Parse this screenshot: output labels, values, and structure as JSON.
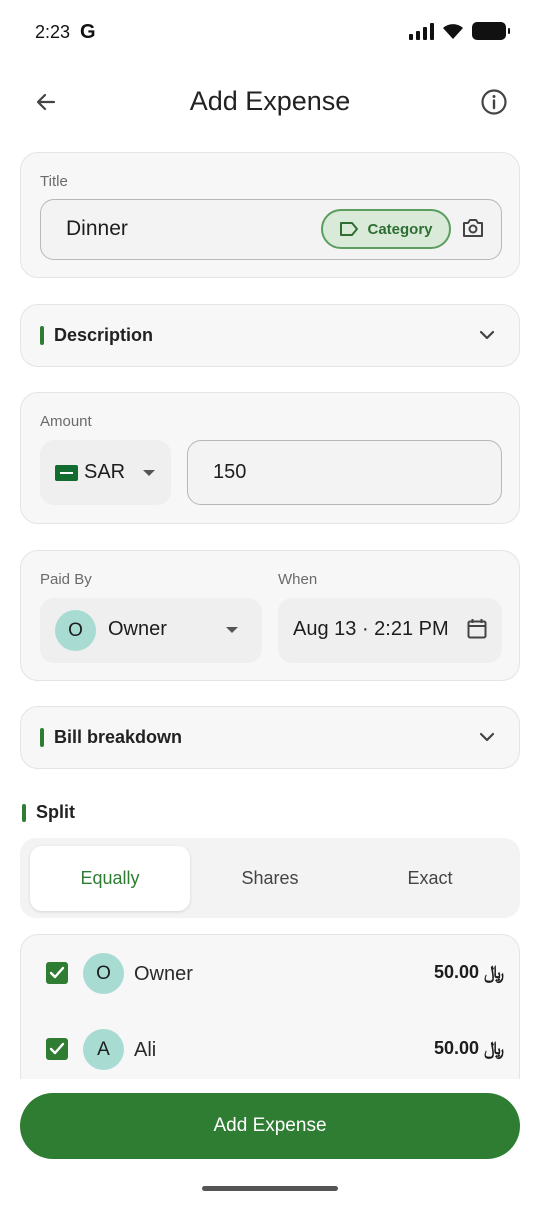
{
  "status_bar": {
    "time": "2:23",
    "carrier_logo": "G"
  },
  "app_bar": {
    "title": "Add Expense",
    "back_icon": "arrow-left-icon",
    "info_icon": "info-icon"
  },
  "title_card": {
    "label": "Title",
    "value": "Dinner",
    "category_label": "Category"
  },
  "description": {
    "label": "Description"
  },
  "amount": {
    "label": "Amount",
    "currency": "SAR",
    "flag": "saudi-flag-icon",
    "value": "150"
  },
  "paid": {
    "paid_by_label": "Paid By",
    "payer_initial": "O",
    "payer_name": "Owner",
    "when_label": "When",
    "when_value": "Aug 13 · 2:21 PM"
  },
  "bill_breakdown": {
    "label": "Bill breakdown"
  },
  "split": {
    "title": "Split",
    "tabs": [
      {
        "label": "Equally",
        "active": true
      },
      {
        "label": "Shares",
        "active": false
      },
      {
        "label": "Exact",
        "active": false
      }
    ],
    "members": [
      {
        "initial": "O",
        "name": "Owner",
        "amount": "50.00 ﷼",
        "checked": true
      },
      {
        "initial": "A",
        "name": "Ali",
        "amount": "50.00 ﷼",
        "checked": true
      }
    ]
  },
  "actions": {
    "add_expense_label": "Add Expense"
  },
  "colors": {
    "accent": "#2e7d32",
    "chip_bg": "#d9ead8",
    "avatar_bg": "#a8dcd3",
    "card_bg": "#f7f7f7"
  }
}
